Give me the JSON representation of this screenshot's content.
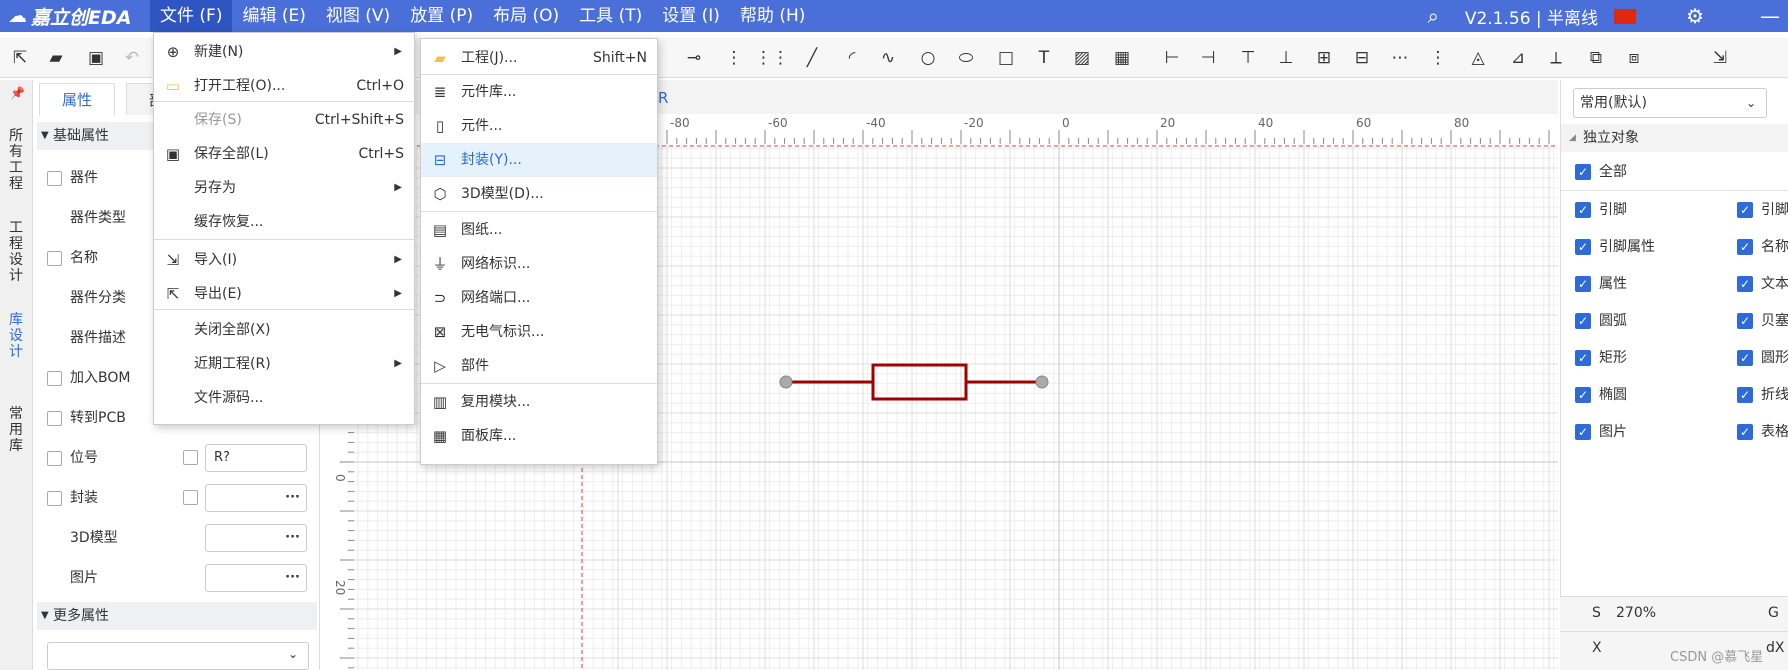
{
  "app": {
    "logo": "嘉立创EDA",
    "version": "V2.1.56 | 半离线"
  },
  "menubar": [
    "文件 (F)",
    "编辑 (E)",
    "视图 (V)",
    "放置 (P)",
    "布局 (O)",
    "工具 (T)",
    "设置 (I)",
    "帮助 (H)"
  ],
  "file_menu": [
    {
      "label": "新建(N)",
      "shortcut": "",
      "submenu": true,
      "icon": "new-file-icon",
      "glyph": "⊕"
    },
    {
      "label": "打开工程(O)...",
      "shortcut": "Ctrl+O",
      "icon": "folder-icon",
      "glyph": "▭"
    },
    {
      "label": "保存(S)",
      "shortcut": "Ctrl+Shift+S",
      "disabled": true,
      "icon": "",
      "glyph": ""
    },
    {
      "label": "保存全部(L)",
      "shortcut": "Ctrl+S",
      "icon": "save-all-icon",
      "glyph": "▣"
    },
    {
      "label": "另存为",
      "shortcut": "",
      "submenu": true,
      "icon": "",
      "glyph": ""
    },
    {
      "label": "缓存恢复...",
      "shortcut": "",
      "icon": "",
      "glyph": ""
    },
    {
      "label": "导入(I)",
      "shortcut": "",
      "submenu": true,
      "icon": "import-icon",
      "glyph": "⇲"
    },
    {
      "label": "导出(E)",
      "shortcut": "",
      "submenu": true,
      "icon": "export-icon",
      "glyph": "⇱"
    },
    {
      "label": "关闭全部(X)",
      "shortcut": "",
      "icon": "",
      "glyph": ""
    },
    {
      "label": "近期工程(R)",
      "shortcut": "",
      "submenu": true,
      "icon": "",
      "glyph": ""
    },
    {
      "label": "文件源码...",
      "shortcut": "",
      "icon": "",
      "glyph": ""
    }
  ],
  "new_submenu": [
    {
      "label": "工程(J)...",
      "shortcut": "Shift+N",
      "icon": "project-folder-icon",
      "glyph": "▰"
    },
    {
      "label": "元件库...",
      "icon": "library-icon",
      "glyph": "≣"
    },
    {
      "label": "元件...",
      "icon": "component-icon",
      "glyph": "▯"
    },
    {
      "label": "封装(Y)...",
      "icon": "footprint-icon",
      "glyph": "⊟",
      "highlight": true
    },
    {
      "label": "3D模型(D)...",
      "icon": "cube-icon",
      "glyph": "⬡"
    },
    {
      "label": "图纸...",
      "icon": "sheet-icon",
      "glyph": "▤"
    },
    {
      "label": "网络标识...",
      "icon": "ground-icon",
      "glyph": "⏚"
    },
    {
      "label": "网络端口...",
      "icon": "port-icon",
      "glyph": "⊃"
    },
    {
      "label": "无电气标识...",
      "icon": "no-electric-icon",
      "glyph": "⊠"
    },
    {
      "label": "部件",
      "icon": "part-icon",
      "glyph": "▷"
    },
    {
      "label": "复用模块...",
      "icon": "module-icon",
      "glyph": "▥"
    },
    {
      "label": "面板库...",
      "icon": "panel-icon",
      "glyph": "▦"
    }
  ],
  "left_strip_tabs": [
    "所有工程",
    "工程设计",
    "库设计",
    "常用库"
  ],
  "left_panel": {
    "tabs": [
      "属性",
      "部件"
    ],
    "section_basic": "基础属性",
    "section_more": "更多属性",
    "rows": [
      "器件",
      "器件类型",
      "名称",
      "器件分类",
      "器件描述",
      "加入BOM",
      "转到PCB",
      "位号",
      "封装",
      "3D模型",
      "图片"
    ],
    "designator_value": "R?",
    "dots": "···"
  },
  "canvas": {
    "tab_label": "R",
    "ruler_labels": [
      "-80",
      "-60",
      "-40",
      "-20",
      "0",
      "20",
      "40",
      "60",
      "80"
    ],
    "vruler_labels": [
      "20",
      "0"
    ]
  },
  "right_panel": {
    "dropdown": "常用(默认)",
    "title": "独立对象",
    "all": "全部",
    "left_col": [
      "引脚",
      "引脚属性",
      "属性",
      "圆弧",
      "矩形",
      "椭圆",
      "图片"
    ],
    "right_col": [
      "引脚",
      "名称",
      "文本",
      "贝塞",
      "圆形",
      "折线",
      "表格"
    ],
    "status": [
      {
        "key": "S",
        "value": "270%",
        "right": "G"
      },
      {
        "key": "X",
        "value": "",
        "right": "dX"
      }
    ]
  },
  "watermark": "CSDN @慕飞星",
  "colors": {
    "menubar": "#4a6fd9",
    "accent": "#2f6bd8",
    "component": "#a00000"
  }
}
